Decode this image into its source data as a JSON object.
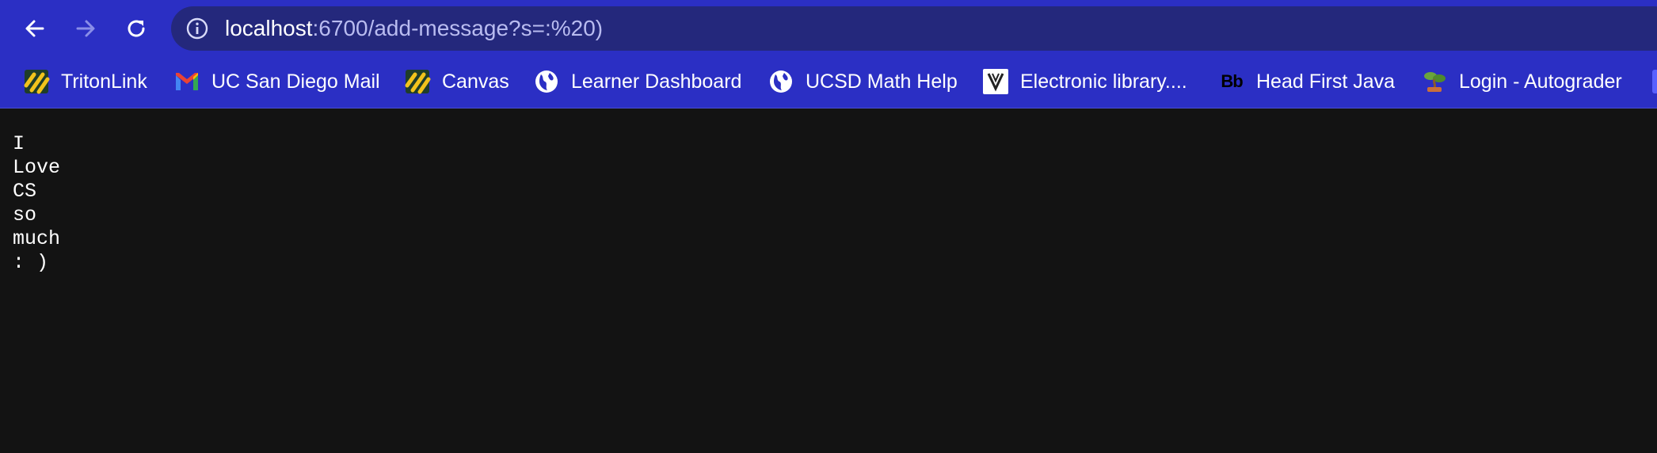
{
  "toolbar": {
    "back_icon": "arrow-left-icon",
    "forward_icon": "arrow-right-icon",
    "reload_icon": "reload-icon",
    "site_info_icon": "info-circle-icon"
  },
  "address_bar": {
    "host": "localhost",
    "rest": ":6700/add-message?s=:%20)"
  },
  "bookmarks": [
    {
      "label": "TritonLink",
      "icon": "tritonlink-favicon"
    },
    {
      "label": "UC San Diego Mail",
      "icon": "gmail-favicon"
    },
    {
      "label": "Canvas",
      "icon": "canvas-favicon"
    },
    {
      "label": "Learner Dashboard",
      "icon": "globe-icon"
    },
    {
      "label": "UCSD Math Help",
      "icon": "globe-icon"
    },
    {
      "label": "Electronic library....",
      "icon": "v-favicon"
    },
    {
      "label": "Head First Java",
      "icon_text": "Bb",
      "icon": "blackboard-favicon"
    },
    {
      "label": "Login - Autograder",
      "icon": "bonsai-favicon"
    }
  ],
  "page": {
    "lines": [
      "I",
      "Love",
      "CS",
      "so",
      "much",
      ": )"
    ]
  },
  "colors": {
    "chrome": "#2b2fc4",
    "omnibox": "#24287c",
    "page_background": "#131313",
    "text": "#ffffff"
  }
}
